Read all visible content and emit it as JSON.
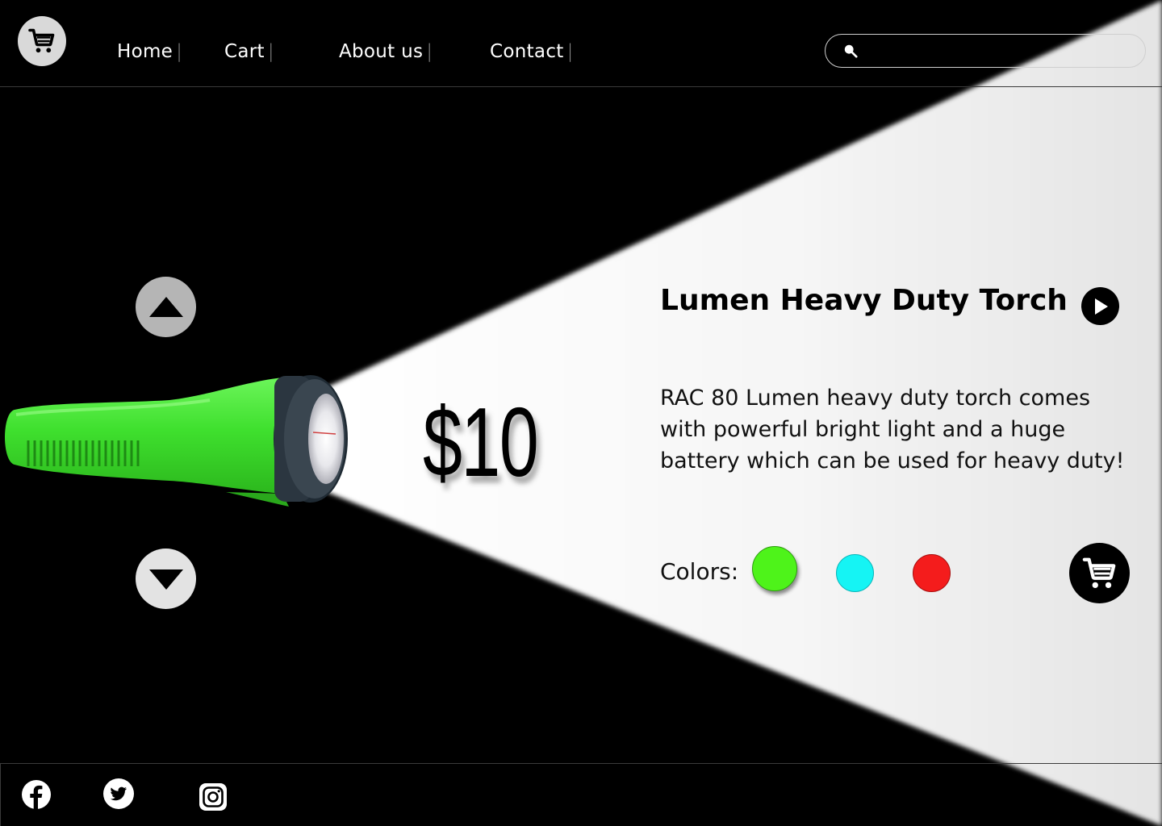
{
  "nav": {
    "items": [
      {
        "label": "Home"
      },
      {
        "label": "Cart"
      },
      {
        "label": "About us"
      },
      {
        "label": "Contact"
      }
    ],
    "separator": "|"
  },
  "search": {
    "placeholder": "",
    "value": ""
  },
  "product": {
    "title": "Lumen Heavy Duty Torch",
    "price": "$10",
    "description": "RAC 80 Lumen heavy duty torch comes with powerful bright light and a huge battery which can be used for heavy duty!",
    "colors_label": "Colors:",
    "colors": [
      {
        "name": "green",
        "hex": "#4ef31a",
        "selected": true
      },
      {
        "name": "cyan",
        "hex": "#15f4f4"
      },
      {
        "name": "red",
        "hex": "#f41c1c"
      }
    ]
  },
  "icons": {
    "logo": "cart-icon",
    "search": "search-icon",
    "up": "triangle-up-icon",
    "down": "triangle-down-icon",
    "play": "play-icon",
    "add_to_cart": "cart-icon",
    "social": [
      "facebook-icon",
      "twitter-icon",
      "instagram-icon"
    ]
  },
  "theme": {
    "background": "#000000",
    "beam": "#f4f4f4",
    "torch_body": "#3ee62e"
  }
}
